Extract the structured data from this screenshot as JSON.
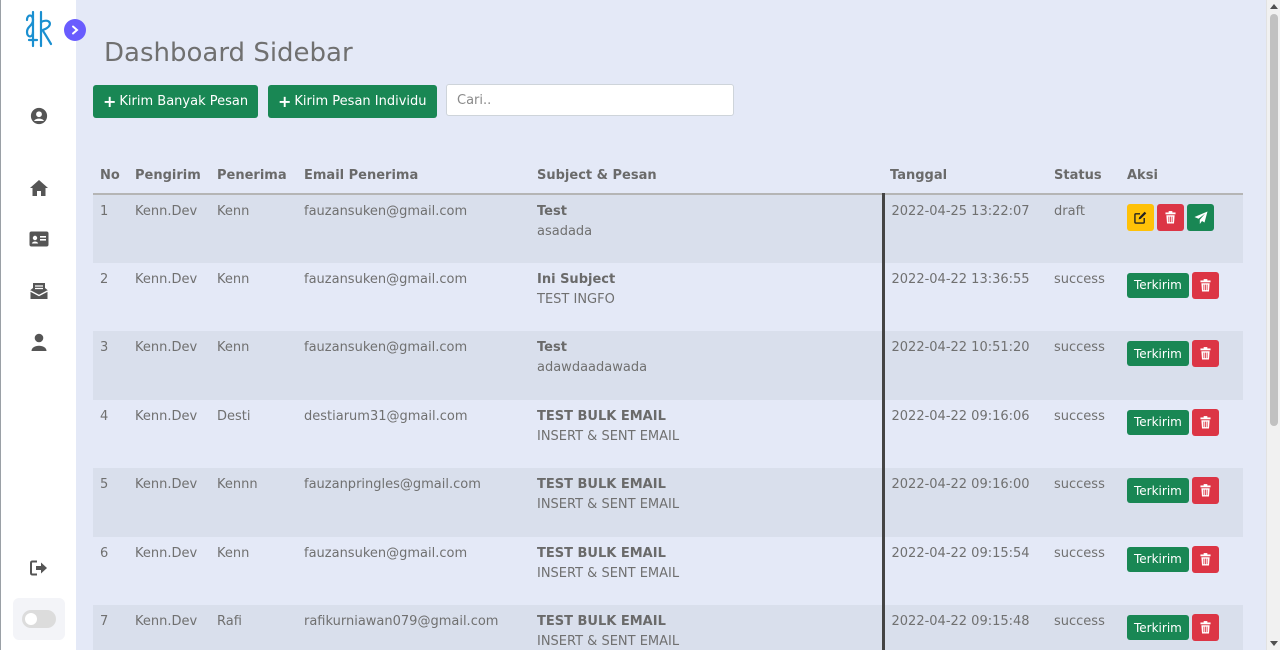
{
  "page": {
    "title": "Dashboard Sidebar"
  },
  "toolbar": {
    "bulk_label": "Kirim Banyak Pesan",
    "individual_label": "Kirim Pesan Individu",
    "search_placeholder": "Cari.."
  },
  "sidebar": {
    "icons": [
      "user-circle-icon",
      "home-icon",
      "id-card-icon",
      "mail-bulk-icon",
      "user-icon",
      "logout-icon"
    ],
    "accent": "#695cfe"
  },
  "table": {
    "headers": [
      "No",
      "Pengirim",
      "Penerima",
      "Email Penerima",
      "Subject & Pesan",
      "Tanggal",
      "Status",
      "Aksi"
    ],
    "sent_label": "Terkirim",
    "rows": [
      {
        "no": "1",
        "sender": "Kenn.Dev",
        "recipient": "Kenn",
        "email": "fauzansuken@gmail.com",
        "subject": "Test",
        "message": "asadada",
        "date": "2022-04-25 13:22:07",
        "status": "draft"
      },
      {
        "no": "2",
        "sender": "Kenn.Dev",
        "recipient": "Kenn",
        "email": "fauzansuken@gmail.com",
        "subject": "Ini Subject",
        "message": "TEST INGFO",
        "date": "2022-04-22 13:36:55",
        "status": "success"
      },
      {
        "no": "3",
        "sender": "Kenn.Dev",
        "recipient": "Kenn",
        "email": "fauzansuken@gmail.com",
        "subject": "Test",
        "message": "adawdaadawada",
        "date": "2022-04-22 10:51:20",
        "status": "success"
      },
      {
        "no": "4",
        "sender": "Kenn.Dev",
        "recipient": "Desti",
        "email": "destiarum31@gmail.com",
        "subject": "TEST BULK EMAIL",
        "message": "INSERT & SENT EMAIL",
        "date": "2022-04-22 09:16:06",
        "status": "success"
      },
      {
        "no": "5",
        "sender": "Kenn.Dev",
        "recipient": "Kennn",
        "email": "fauzanpringles@gmail.com",
        "subject": "TEST BULK EMAIL",
        "message": "INSERT & SENT EMAIL",
        "date": "2022-04-22 09:16:00",
        "status": "success"
      },
      {
        "no": "6",
        "sender": "Kenn.Dev",
        "recipient": "Kenn",
        "email": "fauzansuken@gmail.com",
        "subject": "TEST BULK EMAIL",
        "message": "INSERT & SENT EMAIL",
        "date": "2022-04-22 09:15:54",
        "status": "success"
      },
      {
        "no": "7",
        "sender": "Kenn.Dev",
        "recipient": "Rafi",
        "email": "rafikurniawan079@gmail.com",
        "subject": "TEST BULK EMAIL",
        "message": "INSERT & SENT EMAIL",
        "date": "2022-04-22 09:15:48",
        "status": "success"
      }
    ]
  },
  "colors": {
    "primary_green": "#198754",
    "danger_red": "#dc3545",
    "warning_yellow": "#ffc107",
    "background": "#e4e9f7"
  }
}
